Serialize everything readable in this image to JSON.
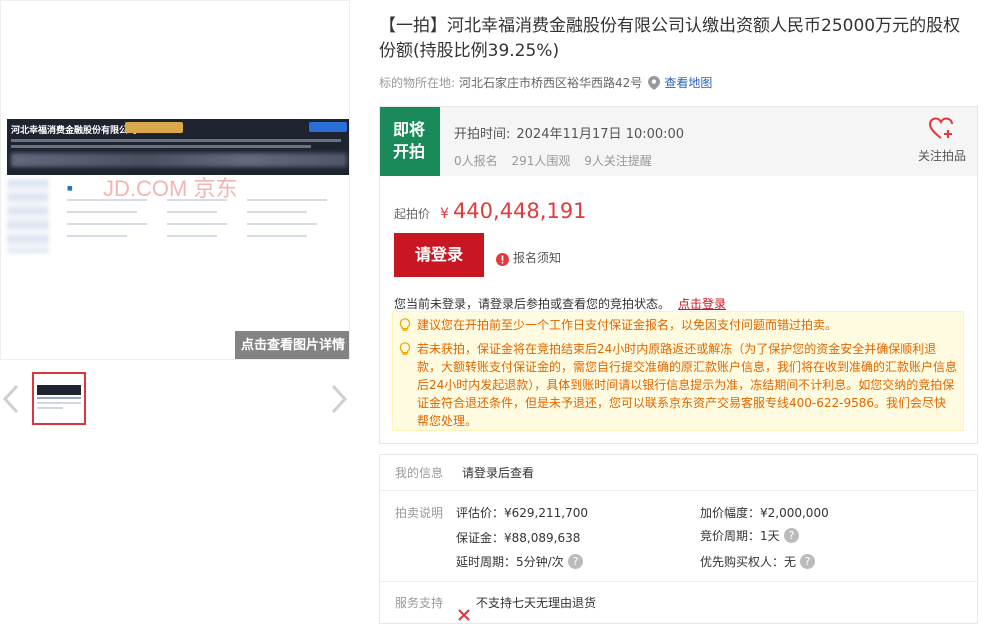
{
  "gallery": {
    "license_company": "河北幸福消费金融股份有限公司",
    "watermark": "JD.COM 京东",
    "zoom_button": "点击查看图片详情"
  },
  "item": {
    "title": "【一拍】河北幸福消费金融股份有限公司认缴出资额人民币25000万元的股权份额(持股比例39.25%)",
    "location_label": "标的物所在地:",
    "location_value": "河北石家庄市桥西区裕华西路42号",
    "map_link": "查看地图"
  },
  "auction": {
    "status": "即将开拍",
    "start_time_label": "开拍时间:",
    "start_time": "2024年11月17日 10:00:00",
    "stats": [
      "0人报名",
      "291人围观",
      "9人关注提醒"
    ],
    "follow_label": "关注拍品",
    "start_price_label": "起拍价",
    "currency": "¥",
    "start_price": "440,448,191",
    "login_button": "请登录",
    "notice_link": "报名须知",
    "login_hint": "您当前未登录，请登录后参拍或查看您的竞拍状态。",
    "login_hint_link": "点击登录",
    "tips": [
      "建议您在开拍前至少一个工作日支付保证金报名，以免因支付问题而错过拍卖。",
      "若未获拍，保证金将在竞拍结束后24小时内原路返还或解冻（为了保护您的资金安全并确保顺利退款，大额转账支付保证金的，需您自行提交准确的原汇款账户信息，我们将在收到准确的汇款账户信息后24小时内发起退款），具体到账时间请以银行信息提示为准，冻结期间不计利息。如您交纳的竞拍保证金符合退还条件，但是未予退还，您可以联系京东资产交易客服专线400-622-9586。我们会尽快帮您处理。"
    ]
  },
  "info": {
    "my_info_label": "我的信息",
    "my_info_value": "请登录后查看",
    "desc_label": "拍卖说明",
    "appraisal": "评估价：¥629,211,700",
    "increment": "加价幅度：¥2,000,000",
    "deposit": "保证金：¥88,089,638",
    "cycle": "竞价周期：1天",
    "delay": "延时周期：5分钟/次",
    "priority": "优先购买权人：无",
    "service_label": "服务支持",
    "service_value": "不支持七天无理由退货"
  },
  "colors": {
    "brand_red": "#c81623",
    "price_red": "#e4393c",
    "status_green": "#1b8a5a",
    "link_blue": "#2a62b8",
    "tip_orange": "#e06600"
  }
}
